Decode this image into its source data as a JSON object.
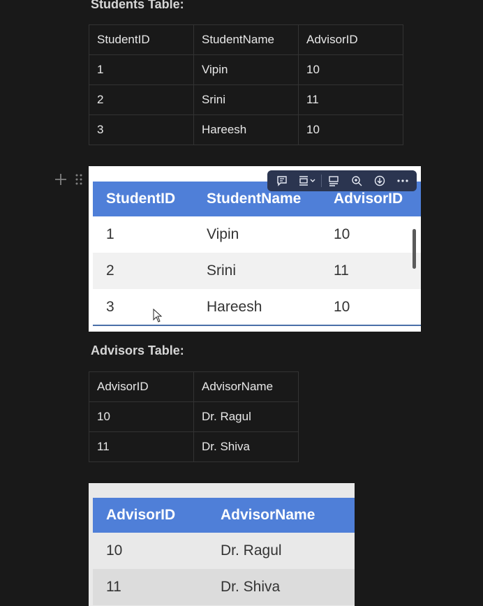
{
  "students": {
    "heading": "Students Table:",
    "headers": [
      "StudentID",
      "StudentName",
      "AdvisorID"
    ],
    "rows": [
      [
        "1",
        "Vipin",
        "10"
      ],
      [
        "2",
        "Srini",
        "11"
      ],
      [
        "3",
        "Hareesh",
        "10"
      ]
    ]
  },
  "students_image": {
    "headers": [
      "StudentID",
      "StudentName",
      "AdvisorID"
    ],
    "rows": [
      [
        "1",
        "Vipin",
        "10"
      ],
      [
        "2",
        "Srini",
        "11"
      ],
      [
        "3",
        "Hareesh",
        "10"
      ]
    ]
  },
  "advisors": {
    "heading": "Advisors Table:",
    "headers": [
      "AdvisorID",
      "AdvisorName"
    ],
    "rows": [
      [
        "10",
        "Dr. Ragul"
      ],
      [
        "11",
        "Dr. Shiva"
      ]
    ]
  },
  "advisors_image": {
    "headers": [
      "AdvisorID",
      "AdvisorName"
    ],
    "rows": [
      [
        "10",
        "Dr. Ragul"
      ],
      [
        "11",
        "Dr. Shiva"
      ]
    ]
  },
  "toolbar": {
    "icons": [
      "comment-icon",
      "align-icon",
      "caption-icon",
      "zoom-in-icon",
      "download-icon",
      "more-icon"
    ]
  },
  "colors": {
    "background": "#191919",
    "table_header": "#4f7fd8",
    "toolbar": "#2b3550"
  }
}
